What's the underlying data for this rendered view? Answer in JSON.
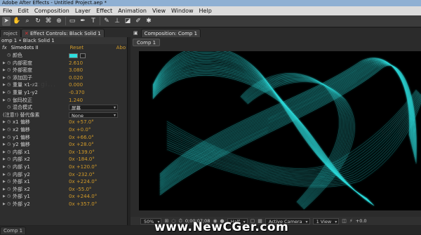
{
  "window": {
    "title": "Adobe After Effects - Untitled Project.aep *"
  },
  "menu": [
    "File",
    "Edit",
    "Composition",
    "Layer",
    "Effect",
    "Animation",
    "View",
    "Window",
    "Help"
  ],
  "left_tabs": {
    "project": "roject",
    "effect_controls": "Effect Controls: Black Solid 1"
  },
  "effect_controls": {
    "path": "omp 1 • Black Solid 1",
    "fx_badge": "fx",
    "effect_name": "Simedots II",
    "reset": "Reset",
    "about": "Abo",
    "watermark_ghost": "...ecgi...",
    "color_label": "颜色",
    "color_value": "#2ddede",
    "params": [
      {
        "name": "内部密度",
        "value": "2.610"
      },
      {
        "name": "外部密度",
        "value": "3.080"
      },
      {
        "name": "添加因子",
        "value": "0.020"
      },
      {
        "name": "重量 x1-x2",
        "value": "0.000"
      },
      {
        "name": "重量 y1-y2",
        "value": "-0.370"
      },
      {
        "name": "伽玛校正",
        "value": "1.240"
      }
    ],
    "blend": {
      "label": "混合模式",
      "value": "屏幕"
    },
    "replace": {
      "label": "(注意!) 替代像素",
      "value": "None"
    },
    "offsets": [
      {
        "name": "x1 偏移",
        "value": "0x +57.0°"
      },
      {
        "name": "x2 偏移",
        "value": "0x +0.0°"
      },
      {
        "name": "y1 偏移",
        "value": "0x +66.0°"
      },
      {
        "name": "y2 偏移",
        "value": "0x +28.0°"
      },
      {
        "name": "内部 x1",
        "value": "0x -139.0°"
      },
      {
        "name": "内部 x2",
        "value": "0x -184.0°"
      },
      {
        "name": "内部 y1",
        "value": "0x +120.0°"
      },
      {
        "name": "内部 y2",
        "value": "0x -232.0°"
      },
      {
        "name": "外部 x1",
        "value": "0x +224.0°"
      },
      {
        "name": "外部 x2",
        "value": "0x -55.0°"
      },
      {
        "name": "外部 y1",
        "value": "0x +244.0°"
      },
      {
        "name": "外部 y2",
        "value": "0x +357.0°"
      }
    ]
  },
  "comp_panel": {
    "tab": "Composition: Comp 1",
    "breadcrumb": "Comp 1",
    "zoom": "50%",
    "timecode": "0;00;07;08",
    "resolution": "Half",
    "camera": "Active Camera",
    "views": "1 View",
    "exposure": "+0.0"
  },
  "bottom_tab": "Comp 1",
  "watermark": "www.NewCGer.com",
  "colors": {
    "accent_value": "#d29b29",
    "ribbon": "#2ddede"
  }
}
